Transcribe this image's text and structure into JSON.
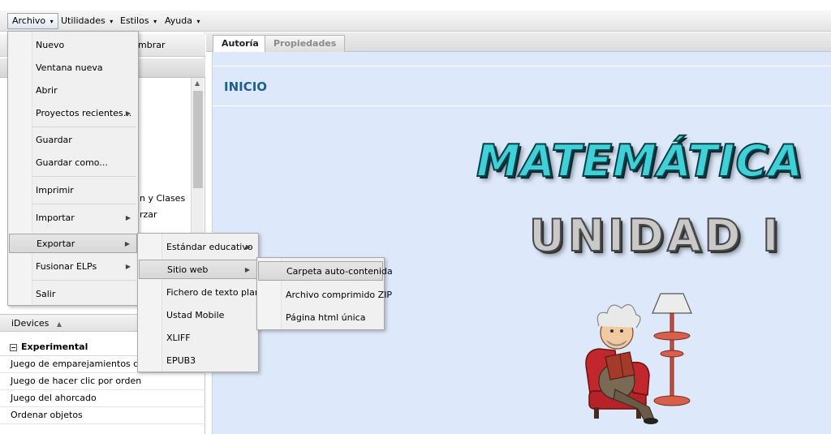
{
  "menubar": {
    "archivo": "Archivo",
    "utilidades": "Utilidades",
    "estilos": "Estilos",
    "ayuda": "Ayuda",
    "caret": "▾"
  },
  "left_panel": {
    "toolbar_fragment": "mbrar",
    "tree_fragments": [
      "n y Clases",
      "rzar"
    ],
    "idevices_label": "iDevices",
    "idevices_arrow": "▲",
    "category": "Experimental",
    "category_toggle": "−",
    "items": [
      "Juego de emparejamientos de n",
      "Juego de hacer clic por orden",
      "Juego del ahorcado",
      "Ordenar objetos"
    ]
  },
  "tabs": {
    "autoria": "Autoría",
    "propiedades": "Propiedades"
  },
  "content": {
    "heading": "INICIO",
    "title_line1": "MATEMÁTICA",
    "title_line2": "UNIDAD I",
    "accent_color": "#1e5f8e",
    "background_color": "#dde9fa"
  },
  "archivo_menu": {
    "items": [
      {
        "label": "Nuevo"
      },
      {
        "label": "Ventana nueva"
      },
      {
        "label": "Abrir"
      },
      {
        "label": "Proyectos recientes..."
      },
      {
        "label": "Guardar"
      },
      {
        "label": "Guardar como..."
      },
      {
        "label": "Imprimir"
      },
      {
        "label": "Importar"
      },
      {
        "label": "Exportar"
      },
      {
        "label": "Fusionar ELPs"
      },
      {
        "label": "Salir"
      }
    ],
    "submenu_arrow": "▶"
  },
  "exportar_menu": {
    "items": [
      {
        "label": "Estándar educativo"
      },
      {
        "label": "Sitio web"
      },
      {
        "label": "Fichero de texto plano"
      },
      {
        "label": "Ustad Mobile"
      },
      {
        "label": "XLIFF"
      },
      {
        "label": "EPUB3"
      }
    ]
  },
  "sitio_web_menu": {
    "items": [
      {
        "label": "Carpeta auto-contenida"
      },
      {
        "label": "Archivo comprimido ZIP"
      },
      {
        "label": "Página html única"
      }
    ]
  }
}
